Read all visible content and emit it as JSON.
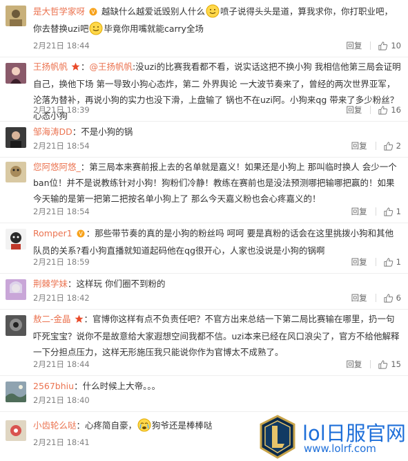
{
  "comments": [
    {
      "user": "是大哲学家呀",
      "text": "越缺什么越爱诋毁别人什么",
      "text2": "喷子说得头头是道，算我求你，你打职业吧，你去替换uzi吧",
      "text3": "毕竟你用嘴就能carry全场",
      "time": "2月21日 18:44",
      "reply": "回复",
      "likes": "10",
      "avatar_color": "#c8b07a"
    },
    {
      "user": "王扬帆帆",
      "mention": "@王扬帆帆",
      "text": ":没uzi的比赛我看都不看，说实话这把不换小狗 我相信他第三局会证明自己，换他下场 第一导致小狗心态炸，第二 外界舆论 一大波节奏来了，曾经的两次世界亚军，沦落为替补，再说小狗的实力也没下滑，上盘输了 锅也不在uzi阿。小狗来qg 带来了多少粉丝？心态小狗",
      "time": "2月21日 18:39",
      "reply": "回复",
      "likes": "16",
      "avatar_color": "#8a5a6a"
    },
    {
      "user": "邹海涛DD",
      "text": "：不是小狗的锅",
      "time": "2月21日 18:54",
      "reply": "回复",
      "likes": "2",
      "avatar_color": "#3a3a3a"
    },
    {
      "user": "您阿悠阿悠_",
      "text": "：第三局本来赛前报上去的名单就是嘉义！如果还是小狗上 那叫临时换人 会少一个ban位！并不是说教练针对小狗！狗粉们冷静！教练在赛前也是没法预测哪把输哪把赢的！如果今天输的是第一把第二把按名单小狗上了 那么今天嘉义粉也会心疼嘉义的！",
      "time": "2月21日 18:54",
      "reply": "回复",
      "likes": "1",
      "avatar_color": "#d9c9a3"
    },
    {
      "user": "Romper1",
      "text": "：那些带节奏的真的是小狗的粉丝吗  呵呵  要是真粉的话会在这里挑拨小狗和其他队员的关系?看小狗直播就知道起码他在qg很开心，人家也没说是小狗的锅啊",
      "time": "2月21日 18:59",
      "reply": "回复",
      "likes": "1",
      "avatar_color": "#2b2b2b"
    },
    {
      "user": "荆棘学妹",
      "text": "：这样玩 你们圈不到粉的",
      "time": "2月21日 18:42",
      "reply": "回复",
      "likes": "6",
      "avatar_color": "#c9a6d8"
    },
    {
      "user": "敖二-金晶",
      "text": "：官博你这样有点不负责任吧？不官方出来总结一下第二局比赛输在哪里，扔一句吓死宝宝？说你不是故意给大家遐想空间我都不信。uzi本来已经在风口浪尖了，官方不给他解释一下分担点压力，这样无形施压我只能说你作为官博太不成熟了。",
      "time": "2月21日 18:44",
      "reply": "回复",
      "likes": "15",
      "avatar_color": "#555555"
    },
    {
      "user": "2567bhiu",
      "text": "：什么时候上大帝。。。",
      "time": "2月21日 18:40",
      "reply": "回复",
      "likes": "",
      "avatar_color": "#8fa3b0"
    },
    {
      "user": "小齿轮么哒",
      "text": "：心疼简自豪，",
      "text2": "狗爷还是棒棒哒",
      "time": "2月21日 18:41",
      "reply": "回复",
      "likes": "",
      "avatar_color": "#e0d6c2"
    }
  ],
  "watermark": {
    "title": "lol日服官网",
    "url": "www.lolrf.com"
  },
  "colors": {
    "username": "#eb7350",
    "meta": "#808080",
    "watermark": "#1e6fd9"
  }
}
